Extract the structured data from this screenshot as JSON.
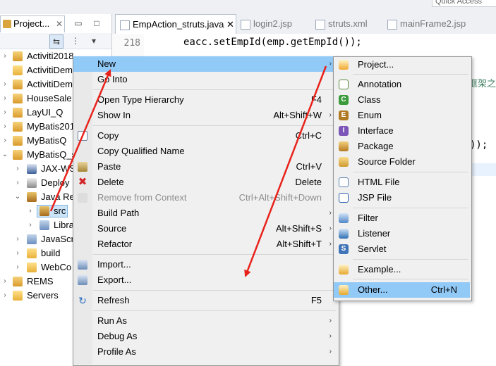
{
  "quick_access": {
    "label": "Quick Access"
  },
  "explorer": {
    "tab_label": "Project...",
    "close_glyph": "✕",
    "tree": [
      {
        "label": "Activiti2018",
        "twisty": "›"
      },
      {
        "label": "ActivitiDem",
        "twisty": ""
      },
      {
        "label": "ActivitiDem",
        "twisty": "›"
      },
      {
        "label": "HouseSale",
        "twisty": "›"
      },
      {
        "label": "LayUI_Q",
        "twisty": "›"
      },
      {
        "label": "MyBatis201",
        "twisty": "›"
      },
      {
        "label": "MyBatisQ",
        "twisty": "›"
      },
      {
        "label": "MyBatisQ_s",
        "twisty": "⌄"
      },
      {
        "label": "JAX-WS",
        "twisty": "›"
      },
      {
        "label": "Deploy",
        "twisty": "›"
      },
      {
        "label": "Java Re",
        "twisty": "⌄"
      },
      {
        "label": "src",
        "twisty": "›"
      },
      {
        "label": "Libra",
        "twisty": "›"
      },
      {
        "label": "JavaScri",
        "twisty": "›"
      },
      {
        "label": "build",
        "twisty": "›"
      },
      {
        "label": "WebCo",
        "twisty": "›"
      },
      {
        "label": "REMS",
        "twisty": "›"
      },
      {
        "label": "Servers",
        "twisty": "›"
      }
    ]
  },
  "editor": {
    "tabs": [
      {
        "label": "EmpAction_struts.java ✕"
      },
      {
        "label": "login2.jsp"
      },
      {
        "label": "struts.xml"
      },
      {
        "label": "mainFrame2.jsp"
      }
    ],
    "line_no": "218",
    "code_line": "eacc.setEmpId(emp.getEmpId());",
    "code_line_field": "emp",
    "code_fragment_top": "eacc.setEmpId(emp.getEmpId());",
    "code_fragment_right": "));",
    "code_fragment_cjk": "框架之"
  },
  "context_menu": {
    "items": [
      {
        "label": "New",
        "shortcut": "",
        "arrow": "›"
      },
      {
        "label": "Go Into",
        "shortcut": "",
        "arrow": ""
      },
      {
        "label": "Open Type Hierarchy",
        "shortcut": "F4",
        "arrow": ""
      },
      {
        "label": "Show In",
        "shortcut": "Alt+Shift+W",
        "arrow": "›"
      },
      {
        "label": "Copy",
        "shortcut": "Ctrl+C",
        "arrow": ""
      },
      {
        "label": "Copy Qualified Name",
        "shortcut": "",
        "arrow": ""
      },
      {
        "label": "Paste",
        "shortcut": "Ctrl+V",
        "arrow": ""
      },
      {
        "label": "Delete",
        "shortcut": "Delete",
        "arrow": ""
      },
      {
        "label": "Remove from Context",
        "shortcut": "Ctrl+Alt+Shift+Down",
        "arrow": ""
      },
      {
        "label": "Build Path",
        "shortcut": "",
        "arrow": "›"
      },
      {
        "label": "Source",
        "shortcut": "Alt+Shift+S",
        "arrow": "›"
      },
      {
        "label": "Refactor",
        "shortcut": "Alt+Shift+T",
        "arrow": "›"
      },
      {
        "label": "Import...",
        "shortcut": "",
        "arrow": ""
      },
      {
        "label": "Export...",
        "shortcut": "",
        "arrow": ""
      },
      {
        "label": "Refresh",
        "shortcut": "F5",
        "arrow": ""
      },
      {
        "label": "Run As",
        "shortcut": "",
        "arrow": "›"
      },
      {
        "label": "Debug As",
        "shortcut": "",
        "arrow": "›"
      },
      {
        "label": "Profile As",
        "shortcut": "",
        "arrow": "›"
      }
    ]
  },
  "new_submenu": {
    "items": [
      {
        "label": "Project..."
      },
      {
        "label": "Annotation"
      },
      {
        "label": "Class"
      },
      {
        "label": "Enum"
      },
      {
        "label": "Interface"
      },
      {
        "label": "Package"
      },
      {
        "label": "Source Folder"
      },
      {
        "label": "HTML File"
      },
      {
        "label": "JSP File"
      },
      {
        "label": "Filter"
      },
      {
        "label": "Listener"
      },
      {
        "label": "Servlet"
      },
      {
        "label": "Example..."
      },
      {
        "label": "Other...",
        "shortcut": "Ctrl+N"
      }
    ]
  },
  "annotation": {
    "arrow_color": "#e8221b"
  },
  "colors": {
    "selection": "#91c9f7",
    "menu_bg": "#f0f0f0"
  }
}
